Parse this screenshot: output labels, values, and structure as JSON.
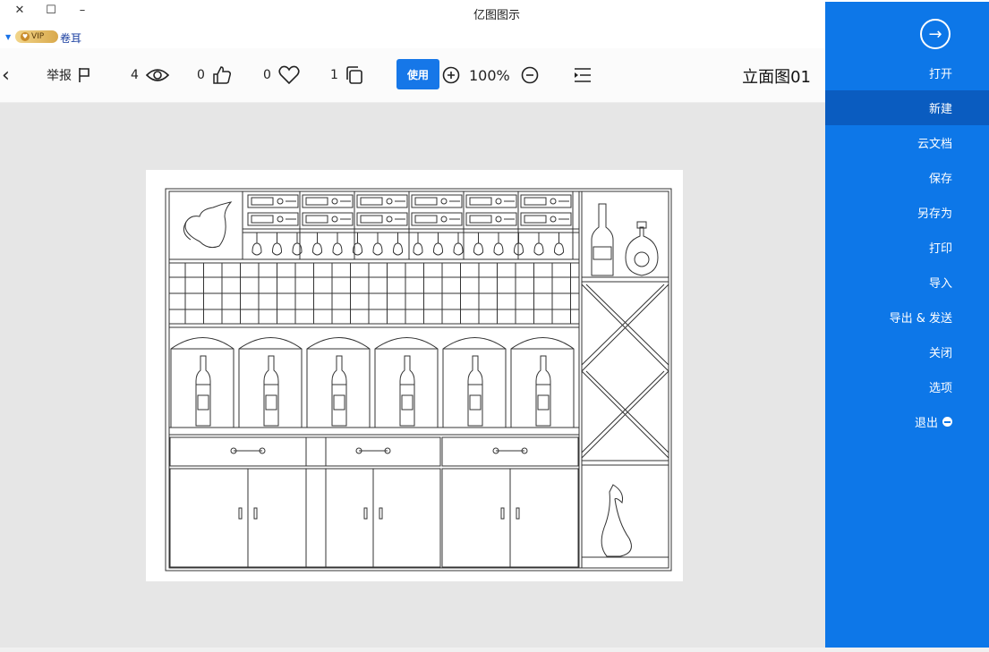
{
  "window": {
    "title": "亿图图示",
    "close_glyph": "✕",
    "maximize_glyph": "☐",
    "minimize_glyph": "–"
  },
  "user": {
    "vip_label": "VIP",
    "name": "卷耳"
  },
  "toolbar": {
    "back_glyph": "‹",
    "report_label": "举报",
    "views_count": "4",
    "likes_count": "0",
    "favorites_count": "0",
    "copies_count": "1",
    "use_label": "使用",
    "zoom_level": "100%",
    "document_title": "立面图01"
  },
  "sidebar": {
    "items": [
      {
        "label": "打开"
      },
      {
        "label": "新建"
      },
      {
        "label": "云文档"
      },
      {
        "label": "保存"
      },
      {
        "label": "另存为"
      },
      {
        "label": "打印"
      },
      {
        "label": "导入"
      },
      {
        "label": "导出 & 发送"
      },
      {
        "label": "关闭"
      },
      {
        "label": "选项"
      },
      {
        "label": "退出"
      }
    ],
    "active_item": "新建"
  },
  "colors": {
    "accent": "#0d77e8",
    "active_menu": "#0a5cc0",
    "canvas_bg": "#e6e6e6"
  }
}
